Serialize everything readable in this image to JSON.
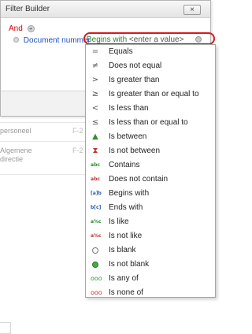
{
  "window": {
    "title": "Filter Builder",
    "close_label": "×"
  },
  "group": {
    "operator": "And"
  },
  "condition": {
    "field": "Document nummer",
    "operator": "Begins with",
    "value": "<enter a value>"
  },
  "background_rows": [
    {
      "label_line1": "personeel",
      "label_line2": "",
      "code": "F-2"
    },
    {
      "label_line1": "Algemene",
      "label_line2": "directie",
      "code": "F-2"
    }
  ],
  "menu": {
    "items": [
      {
        "label": "Equals",
        "icon": "equals-icon"
      },
      {
        "label": "Does not equal",
        "icon": "not-equal-icon"
      },
      {
        "label": "Is greater than",
        "icon": "greater-than-icon"
      },
      {
        "label": "Is greater than or equal to",
        "icon": "greater-equal-icon"
      },
      {
        "label": "Is less than",
        "icon": "less-than-icon"
      },
      {
        "label": "Is less than or equal to",
        "icon": "less-equal-icon"
      },
      {
        "label": "Is between",
        "icon": "between-icon"
      },
      {
        "label": "Is not between",
        "icon": "not-between-icon"
      },
      {
        "label": "Contains",
        "icon": "contains-icon"
      },
      {
        "label": "Does not contain",
        "icon": "not-contain-icon"
      },
      {
        "label": "Begins with",
        "icon": "begins-with-icon"
      },
      {
        "label": "Ends with",
        "icon": "ends-with-icon"
      },
      {
        "label": "Is like",
        "icon": "like-icon"
      },
      {
        "label": "Is not like",
        "icon": "not-like-icon"
      },
      {
        "label": "Is blank",
        "icon": "blank-icon"
      },
      {
        "label": "Is not blank",
        "icon": "not-blank-icon"
      },
      {
        "label": "Is any of",
        "icon": "any-of-icon"
      },
      {
        "label": "Is none of",
        "icon": "none-of-icon"
      }
    ]
  },
  "colors": {
    "group_operator": "#d40000",
    "field": "#1a4fc9",
    "operator": "#2e7d32",
    "highlight_ring": "#d61a1a"
  }
}
